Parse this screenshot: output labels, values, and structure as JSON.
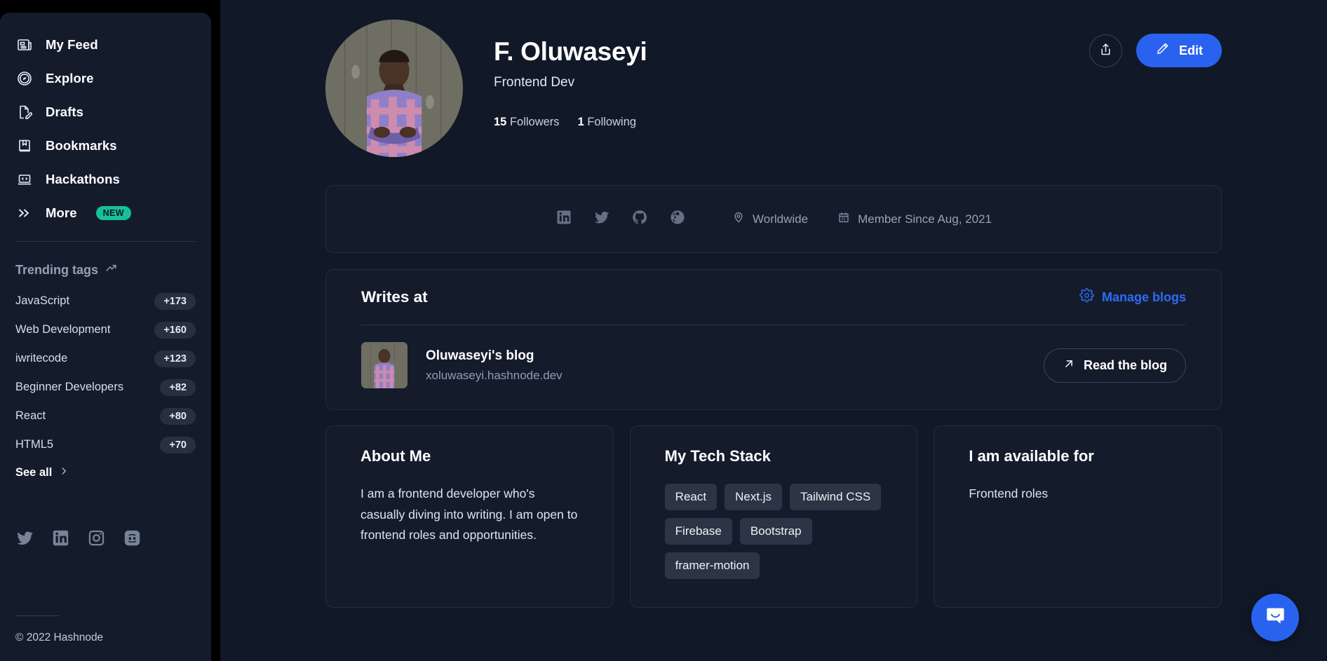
{
  "sidebar": {
    "nav_items": [
      {
        "label": "My Feed",
        "icon": "feed-icon"
      },
      {
        "label": "Explore",
        "icon": "compass-icon"
      },
      {
        "label": "Drafts",
        "icon": "draft-pencil-icon"
      },
      {
        "label": "Bookmarks",
        "icon": "bookmark-icon"
      },
      {
        "label": "Hackathons",
        "icon": "laptop-code-icon"
      },
      {
        "label": "More",
        "icon": "chevrons-right-icon",
        "badge": "NEW"
      }
    ],
    "trending_title": "Trending tags",
    "trending_icon": "trending-up-icon",
    "tags": [
      {
        "name": "JavaScript",
        "count": "+173"
      },
      {
        "name": "Web Development",
        "count": "+160"
      },
      {
        "name": "iwritecode",
        "count": "+123"
      },
      {
        "name": "Beginner Developers",
        "count": "+82"
      },
      {
        "name": "React",
        "count": "+80"
      },
      {
        "name": "HTML5",
        "count": "+70"
      }
    ],
    "see_all": "See all",
    "socials": [
      "twitter-icon",
      "linkedin-icon",
      "instagram-icon",
      "discord-icon"
    ],
    "copyright": "© 2022 Hashnode"
  },
  "profile": {
    "name": "F. Oluwaseyi",
    "title": "Frontend Dev",
    "followers_count": "15",
    "followers_label": "Followers",
    "following_count": "1",
    "following_label": "Following",
    "share_icon": "share-icon",
    "edit_label": "Edit",
    "edit_icon": "pencil-icon",
    "avatar_alt": "profile-photo"
  },
  "meta": {
    "social_icons": [
      "linkedin-icon",
      "twitter-icon",
      "github-icon",
      "website-globe-icon"
    ],
    "location_icon": "map-pin-icon",
    "location": "Worldwide",
    "calendar_icon": "calendar-icon",
    "member_since": "Member Since Aug, 2021"
  },
  "writes_at": {
    "title": "Writes at",
    "manage_label": "Manage blogs",
    "manage_icon": "gear-icon",
    "blog_name": "Oluwaseyi's blog",
    "blog_url": "xoluwaseyi.hashnode.dev",
    "read_label": "Read the blog",
    "read_icon": "arrow-up-right-icon"
  },
  "about": {
    "title": "About Me",
    "body": "I am a frontend developer who's casually diving into writing. I am open to frontend roles and opportunities."
  },
  "tech_stack": {
    "title": "My Tech Stack",
    "items": [
      "React",
      "Next.js",
      "Tailwind CSS",
      "Firebase",
      "Bootstrap",
      "framer-motion"
    ]
  },
  "available": {
    "title": "I am available for",
    "body": "Frontend roles"
  },
  "intercom": {
    "icon": "chat-bubble-icon"
  },
  "colors": {
    "page_bg": "#111827",
    "sidebar_bg": "#141c2c",
    "card_bg": "#141c2c",
    "card_border": "#232d41",
    "accent_blue": "#2a62f0",
    "badge_green": "#18c098",
    "muted_text": "#8e9bb0",
    "chip_bg": "#2c3545"
  }
}
